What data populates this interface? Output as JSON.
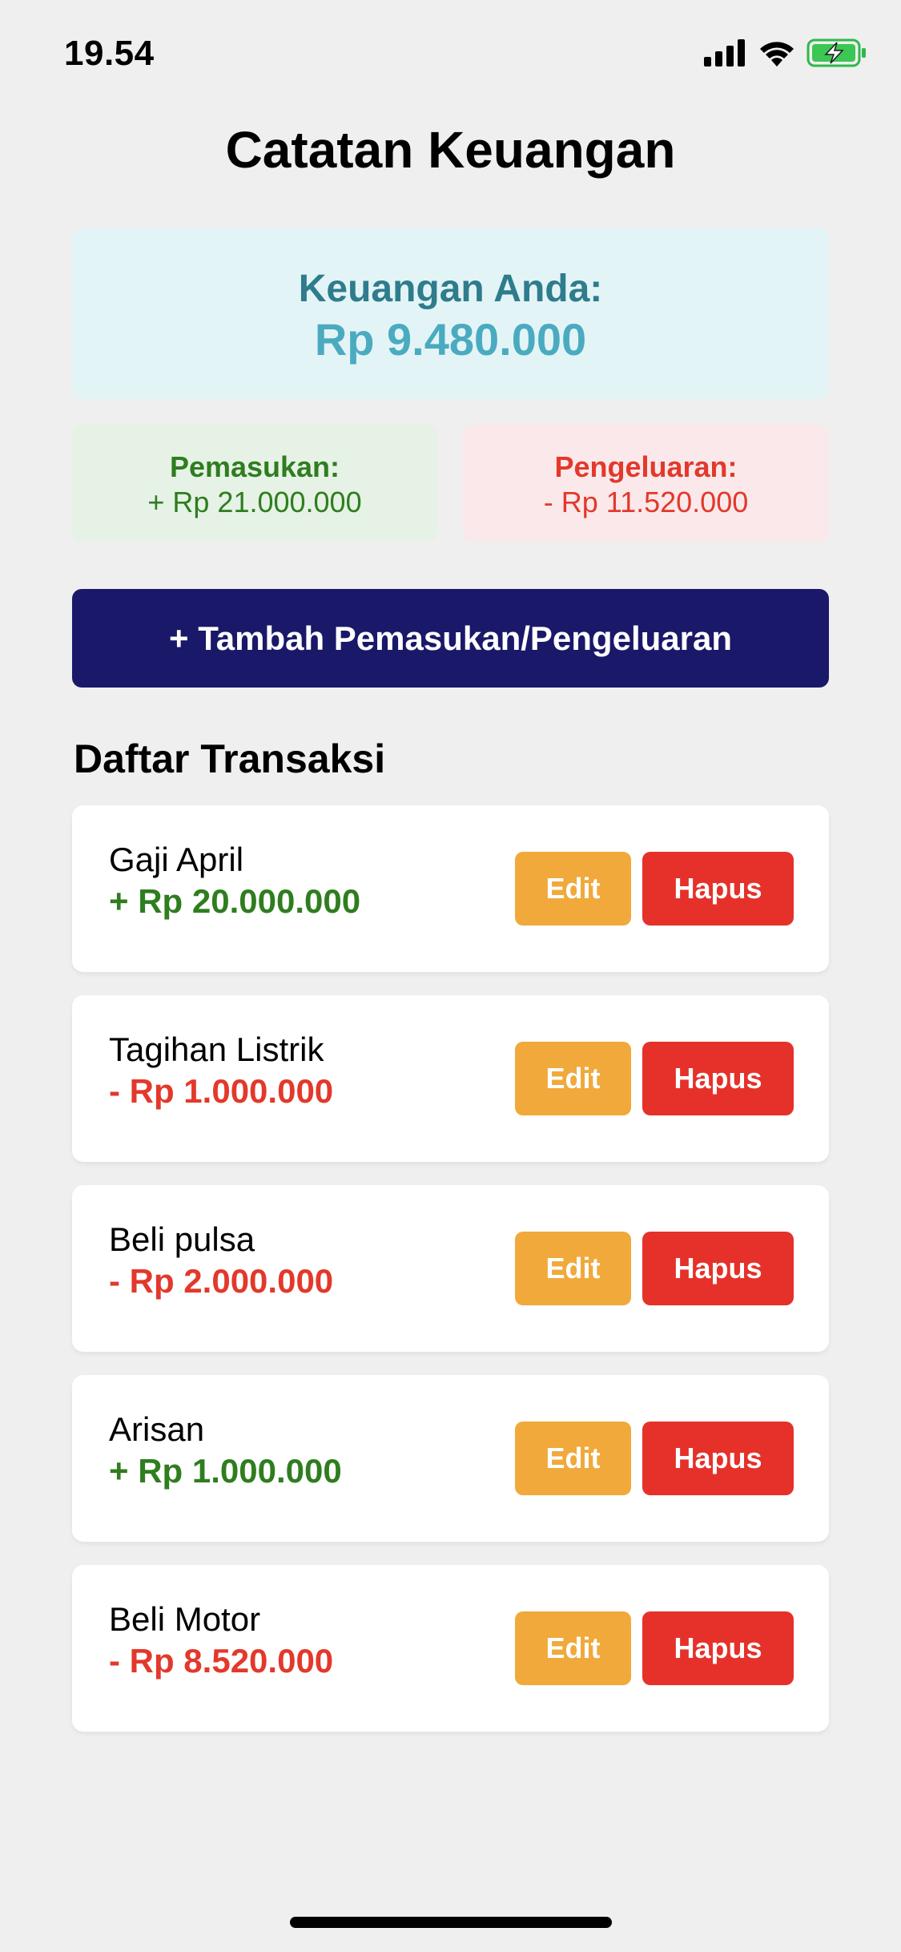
{
  "status_bar": {
    "time": "19.54",
    "icons": [
      "cellular-signal-icon",
      "wifi-icon",
      "battery-charging-icon"
    ]
  },
  "header": {
    "title": "Catatan Keuangan"
  },
  "balance": {
    "label": "Keuangan Anda:",
    "value": "Rp 9.480.000"
  },
  "summary": {
    "income_label": "Pemasukan:",
    "income_value": "+ Rp 21.000.000",
    "expense_label": "Pengeluaran:",
    "expense_value": "- Rp 11.520.000"
  },
  "add_button": {
    "label": "+ Tambah Pemasukan/Pengeluaran"
  },
  "transactions": {
    "title": "Daftar Transaksi",
    "edit_label": "Edit",
    "delete_label": "Hapus",
    "items": [
      {
        "name": "Gaji April",
        "amount": "+ Rp 20.000.000",
        "type": "income"
      },
      {
        "name": "Tagihan Listrik",
        "amount": "- Rp 1.000.000",
        "type": "expense"
      },
      {
        "name": "Beli pulsa",
        "amount": "- Rp 2.000.000",
        "type": "expense"
      },
      {
        "name": "Arisan",
        "amount": "+ Rp 1.000.000",
        "type": "income"
      },
      {
        "name": "Beli Motor",
        "amount": "- Rp 8.520.000",
        "type": "expense"
      }
    ]
  },
  "colors": {
    "background": "#efefef",
    "balance_bg": "#e3f4f7",
    "balance_label": "#2e7c8c",
    "balance_value": "#4aabc0",
    "income": "#2f7d1f",
    "income_bg": "#e6f2e6",
    "expense": "#e2392b",
    "expense_bg": "#fbe8ea",
    "primary_button": "#1a1869",
    "edit_button": "#f0a93a",
    "delete_button": "#e5312a"
  }
}
